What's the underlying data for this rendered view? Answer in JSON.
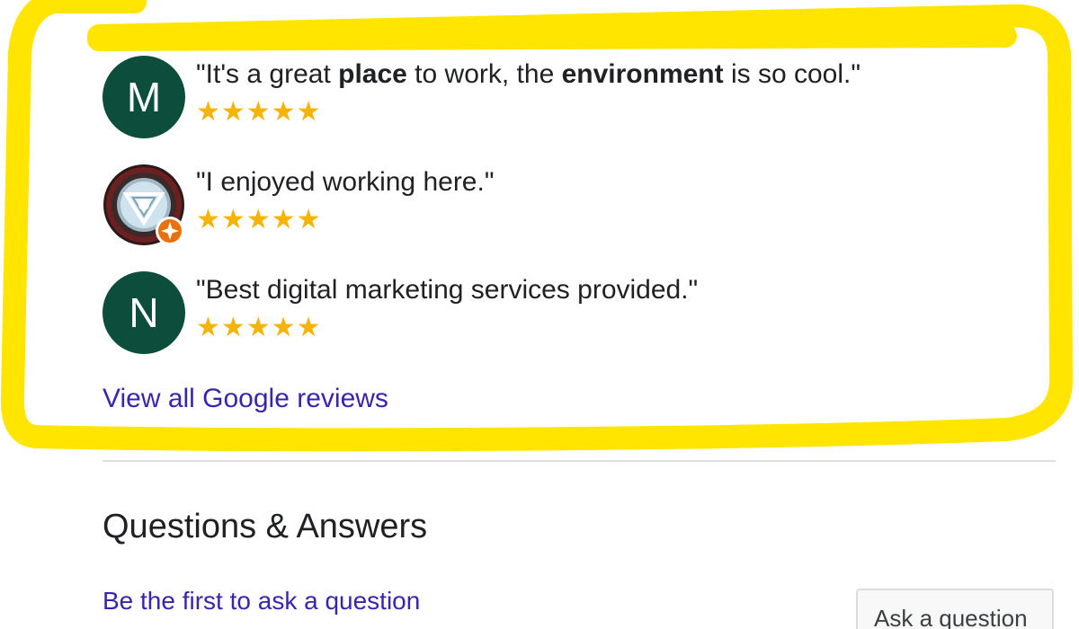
{
  "reviews": [
    {
      "avatar_letter": "M",
      "avatar_color": "#0c4d3c",
      "quote_parts": [
        "\"It's a great ",
        "place",
        " to work, the ",
        "environment",
        " is so cool.\""
      ],
      "rating": 5,
      "stars": "★★★★★"
    },
    {
      "avatar_icon": "arc-reactor-icon",
      "badge_icon": "local-guide-badge-icon",
      "quote": "\"I enjoyed working here.\"",
      "rating": 5,
      "stars": "★★★★★"
    },
    {
      "avatar_letter": "N",
      "avatar_color": "#0c4d3c",
      "quote": "\"Best digital marketing services provided.\"",
      "rating": 5,
      "stars": "★★★★★"
    }
  ],
  "view_all_link": "View all Google reviews",
  "qa": {
    "title": "Questions & Answers",
    "first_question_link": "Be the first to ask a question",
    "ask_button": "Ask a question"
  },
  "colors": {
    "highlight": "#ffe500",
    "star": "#f5b400",
    "link": "#3725b0",
    "badge": "#e8710a"
  }
}
